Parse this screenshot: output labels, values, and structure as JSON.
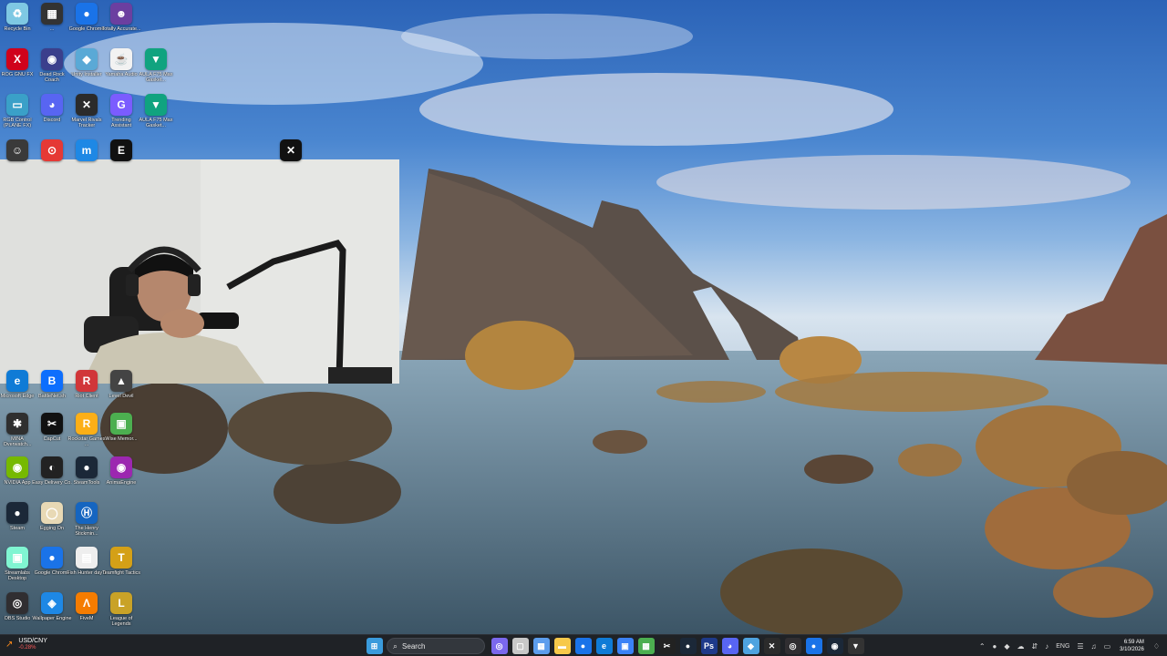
{
  "desktop_icons": [
    {
      "label": "Recycle Bin",
      "symbol": "♻",
      "color": "#7ec8e3",
      "icon": "recycle-bin-icon"
    },
    {
      "label": "...",
      "symbol": "▦",
      "color": "#333333",
      "icon": "app-icon"
    },
    {
      "label": "Google Chrome",
      "symbol": "●",
      "color": "#1a73e8",
      "icon": "chrome-icon"
    },
    {
      "label": "Totally Accurate...",
      "symbol": "☻",
      "color": "#6b3fa0",
      "icon": "game-icon"
    },
    {
      "label": "ROG GNU FX",
      "symbol": "X",
      "color": "#d0021b",
      "icon": "rog-icon"
    },
    {
      "label": "Dead Rock Coach",
      "symbol": "◉",
      "color": "#3b3f8c",
      "icon": "app-icon"
    },
    {
      "label": "Unity Installer",
      "symbol": "◆",
      "color": "#5aa9d6",
      "icon": "unity-icon"
    },
    {
      "label": "Yamaha Audio",
      "symbol": "☕",
      "color": "#f2f2f2",
      "icon": "java-icon"
    },
    {
      "label": "AULA F75 Max Gasket...",
      "symbol": "▼",
      "color": "#10a37f",
      "icon": "keyboard-icon"
    },
    {
      "label": "RGB Control (PLANE FX)",
      "symbol": "▭",
      "color": "#3aa0c8",
      "icon": "monitor-icon"
    },
    {
      "label": "Discord",
      "symbol": "◕",
      "color": "#5865f2",
      "icon": "discord-icon"
    },
    {
      "label": "Marvel Rivals Tracker",
      "symbol": "✕",
      "color": "#2b2b2b",
      "icon": "tracker-icon"
    },
    {
      "label": "Trending Assistant",
      "symbol": "G",
      "color": "#7b5cff",
      "icon": "assistant-icon"
    },
    {
      "label": "AULA F75 Max Gasket...",
      "symbol": "▼",
      "color": "#10a37f",
      "icon": "keyboard-icon"
    },
    {
      "label": "",
      "symbol": "☺",
      "color": "#3a3a3a",
      "icon": "app-icon"
    },
    {
      "label": "",
      "symbol": "⊙",
      "color": "#e53935",
      "icon": "maps-icon"
    },
    {
      "label": "",
      "symbol": "m",
      "color": "#1e88e5",
      "icon": "app-icon"
    },
    {
      "label": "",
      "symbol": "E",
      "color": "#111111",
      "icon": "epic-games-icon"
    },
    {
      "label": "",
      "symbol": "✕",
      "color": "#111111",
      "icon": "app-icon"
    },
    {
      "label": "Microsoft Edge",
      "symbol": "e",
      "color": "#0f7bd6",
      "icon": "edge-icon"
    },
    {
      "label": "BattleNet.sh",
      "symbol": "B",
      "color": "#0d6efd",
      "icon": "battlenet-icon"
    },
    {
      "label": "Riot Client",
      "symbol": "R",
      "color": "#d13639",
      "icon": "riot-icon"
    },
    {
      "label": "Level Devil",
      "symbol": "▲",
      "color": "#444444",
      "icon": "game-icon"
    },
    {
      "label": "MINA Overwatch...",
      "symbol": "✱",
      "color": "#2f2f2f",
      "icon": "overwatch-icon"
    },
    {
      "label": "CapCut",
      "symbol": "✂",
      "color": "#111111",
      "icon": "capcut-icon"
    },
    {
      "label": "Rockstar Games ...",
      "symbol": "R",
      "color": "#fcaf17",
      "icon": "rockstar-icon"
    },
    {
      "label": "Wise Memor...",
      "symbol": "▣",
      "color": "#4caf50",
      "icon": "memory-icon"
    },
    {
      "label": "NVIDIA App",
      "symbol": "◉",
      "color": "#76b900",
      "icon": "nvidia-icon"
    },
    {
      "label": "Easy Delivery Co.",
      "symbol": "◐",
      "color": "#222222",
      "icon": "game-icon"
    },
    {
      "label": "SteamTools",
      "symbol": "●",
      "color": "#1b2838",
      "icon": "steamtools-icon"
    },
    {
      "label": "AnimaEngine",
      "symbol": "◉",
      "color": "#9c27b0",
      "icon": "anima-icon"
    },
    {
      "label": "Steam",
      "symbol": "●",
      "color": "#1b2838",
      "icon": "steam-icon"
    },
    {
      "label": "Egging On",
      "symbol": "◯",
      "color": "#e8d9b5",
      "icon": "egg-icon"
    },
    {
      "label": "The Henry Stickmin...",
      "symbol": "Ⓗ",
      "color": "#1565c0",
      "icon": "game-icon"
    },
    {
      "label": "Streamlabs Desktop",
      "symbol": "▣",
      "color": "#80f5d2",
      "icon": "streamlabs-icon"
    },
    {
      "label": "Google Chrome",
      "symbol": "●",
      "color": "#1a73e8",
      "icon": "chrome-icon"
    },
    {
      "label": "Fish Hunter day 1",
      "symbol": "▤",
      "color": "#eeeeee",
      "icon": "document-icon"
    },
    {
      "label": "Teamfight Tactics",
      "symbol": "T",
      "color": "#d4a017",
      "icon": "tft-icon"
    },
    {
      "label": "OBS Studio",
      "symbol": "◎",
      "color": "#302e31",
      "icon": "obs-icon"
    },
    {
      "label": "Wallpaper Engine",
      "symbol": "◈",
      "color": "#1e88e5",
      "icon": "wallpaper-engine-icon"
    },
    {
      "label": "FiveM",
      "symbol": "Λ",
      "color": "#f57c00",
      "icon": "fivem-icon"
    },
    {
      "label": "League of Legends",
      "symbol": "L",
      "color": "#c9a227",
      "icon": "league-icon"
    }
  ],
  "taskbar": {
    "stock_symbol": "USD/CNY",
    "stock_change": "-0.28%",
    "search_placeholder": "Search",
    "pinned": [
      {
        "name": "start-button",
        "symbol": "⊞",
        "color": "#3a9bdc"
      },
      {
        "name": "search-button",
        "symbol": "",
        "color": ""
      },
      {
        "name": "copilot-icon",
        "symbol": "◎",
        "color": "#7b68ee"
      },
      {
        "name": "task-view-icon",
        "symbol": "▢",
        "color": "#c8c8c8"
      },
      {
        "name": "widgets-icon",
        "symbol": "▦",
        "color": "#5c9ded"
      },
      {
        "name": "file-explorer-icon",
        "symbol": "▬",
        "color": "#f7c94a"
      },
      {
        "name": "chrome-icon",
        "symbol": "●",
        "color": "#1a73e8"
      },
      {
        "name": "edge-icon",
        "symbol": "e",
        "color": "#0f7bd6"
      },
      {
        "name": "store-icon",
        "symbol": "▣",
        "color": "#3b82f6"
      },
      {
        "name": "minecraft-icon",
        "symbol": "▩",
        "color": "#4caf50"
      },
      {
        "name": "capcut-icon",
        "symbol": "✂",
        "color": "#222222"
      },
      {
        "name": "steam-icon",
        "symbol": "●",
        "color": "#1b2838"
      },
      {
        "name": "powershell-icon",
        "symbol": "Ps",
        "color": "#1e3a8a"
      },
      {
        "name": "discord-icon",
        "symbol": "◕",
        "color": "#5865f2"
      },
      {
        "name": "vpn-icon",
        "symbol": "◆",
        "color": "#4ea3e0"
      },
      {
        "name": "tracker-icon",
        "symbol": "✕",
        "color": "#2b2b2b"
      },
      {
        "name": "obs-icon",
        "symbol": "◎",
        "color": "#302e31"
      },
      {
        "name": "chrome-active-icon",
        "symbol": "●",
        "color": "#1a73e8"
      },
      {
        "name": "steamtools-icon",
        "symbol": "◉",
        "color": "#1b2838"
      },
      {
        "name": "lol-client-icon",
        "symbol": "▼",
        "color": "#333333"
      }
    ],
    "tray": {
      "language": "ENG",
      "time": "6:59 AM",
      "date": "3/10/2026"
    }
  }
}
